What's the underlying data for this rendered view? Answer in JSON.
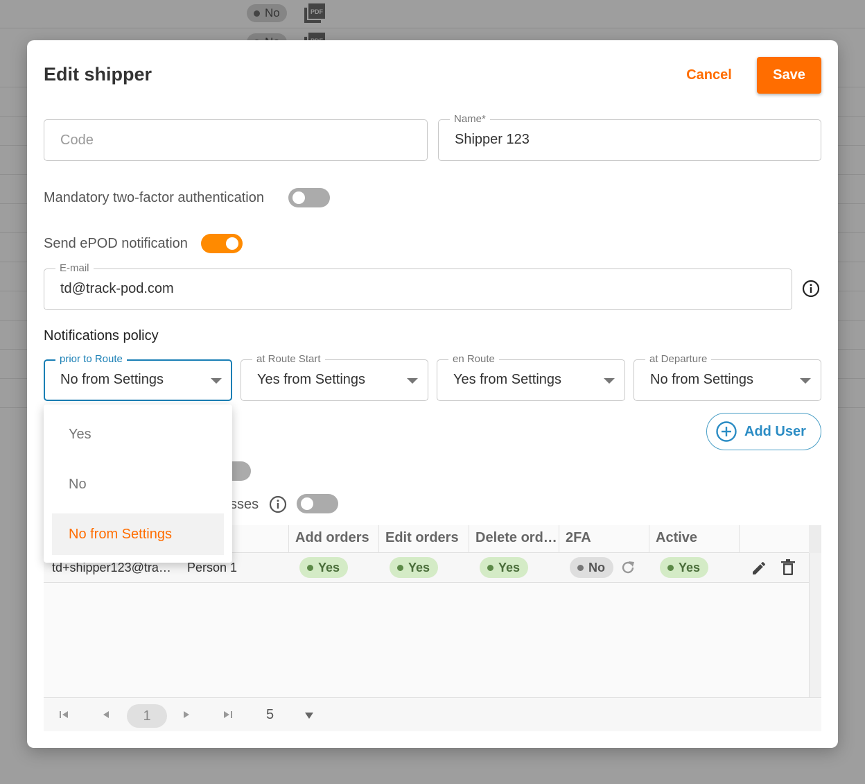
{
  "background": {
    "pill_label": "No",
    "pdf_icon_text": "PDF"
  },
  "dialog": {
    "title": "Edit shipper",
    "cancel_label": "Cancel",
    "save_label": "Save",
    "code": {
      "placeholder": "Code",
      "value": ""
    },
    "name": {
      "label": "Name*",
      "value": "Shipper 123"
    },
    "mandatory_2fa": {
      "label": "Mandatory two-factor authentication",
      "on": false
    },
    "send_epod": {
      "label": "Send ePOD notification",
      "on": true
    },
    "email": {
      "label": "E-mail",
      "value": "td@track-pod.com"
    },
    "notifications_policy": {
      "title": "Notifications policy",
      "selects": [
        {
          "label": "prior to Route",
          "value": "No from Settings"
        },
        {
          "label": "at Route Start",
          "value": "Yes from Settings"
        },
        {
          "label": "en Route",
          "value": "Yes from Settings"
        },
        {
          "label": "at Departure",
          "value": "No from Settings"
        }
      ]
    },
    "add_user_label": "Add User",
    "partial_toggle_label": "sses",
    "dropdown_options": [
      {
        "label": "Yes",
        "selected": false
      },
      {
        "label": "No",
        "selected": false
      },
      {
        "label": "No from Settings",
        "selected": true
      }
    ],
    "table": {
      "columns": [
        "Add orders",
        "Edit orders",
        "Delete ord…",
        "2FA",
        "Active"
      ],
      "rows": [
        {
          "email": "td+shipper123@tra…",
          "name": "Person 1",
          "add_orders": "Yes",
          "edit_orders": "Yes",
          "delete_orders": "Yes",
          "two_fa": "No",
          "active": "Yes"
        }
      ]
    },
    "pager": {
      "current_page": "1",
      "page_size": "5"
    }
  },
  "colors": {
    "accent": "#ff6d00",
    "focus": "#1a7fb5",
    "add_user": "#2b8cc4",
    "yes_pill": "#d4ebc6",
    "no_pill": "#dedede"
  }
}
